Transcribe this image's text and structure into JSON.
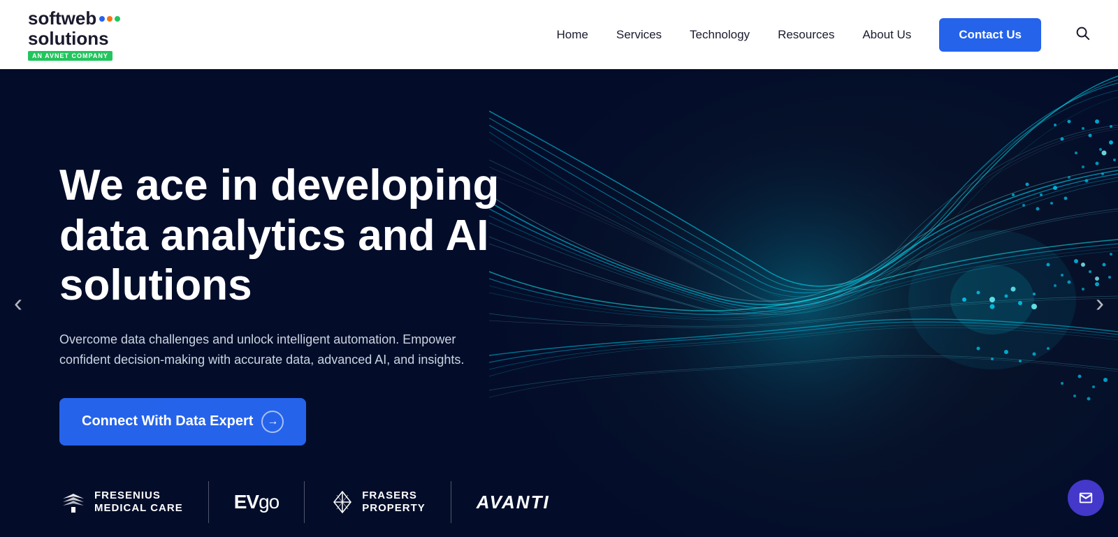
{
  "header": {
    "logo": {
      "line1": "softweb",
      "line2": "solutions",
      "badge": "AN AVNET COMPANY"
    },
    "nav": {
      "items": [
        {
          "label": "Home",
          "id": "home"
        },
        {
          "label": "Services",
          "id": "services"
        },
        {
          "label": "Technology",
          "id": "technology"
        },
        {
          "label": "Resources",
          "id": "resources"
        },
        {
          "label": "About Us",
          "id": "about"
        }
      ],
      "contact_label": "Contact Us"
    }
  },
  "hero": {
    "title": "We ace in developing data analytics and AI solutions",
    "subtitle": "Overcome data challenges and unlock intelligent automation. Empower confident decision-making with accurate data, advanced AI, and insights.",
    "cta_label": "Connect With Data Expert"
  },
  "clients": [
    {
      "name": "FRESENIUS\nMEDICAL CARE",
      "id": "fresenius"
    },
    {
      "name": "EVgo",
      "id": "evgo"
    },
    {
      "name": "FRASERS\nPROPERTY",
      "id": "frasers"
    },
    {
      "name": "AVANTI",
      "id": "avanti"
    }
  ],
  "carousel": {
    "left_arrow": "‹",
    "right_arrow": "›"
  },
  "chat": {
    "icon": "✉"
  }
}
